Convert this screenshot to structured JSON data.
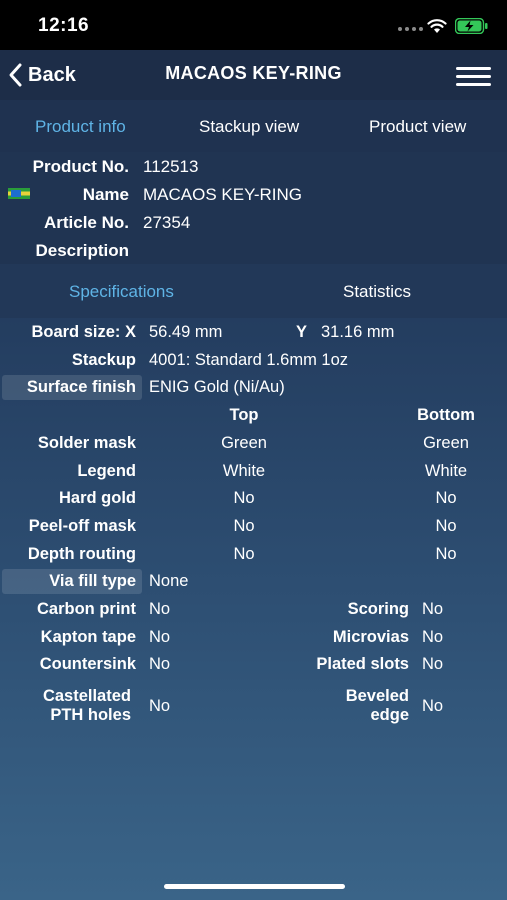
{
  "status": {
    "time": "12:16",
    "icons": [
      "wifi-icon",
      "battery-charging-icon"
    ],
    "battery_color": "#34c759"
  },
  "nav": {
    "back_label": "Back",
    "title": "MACAOS KEY-RING",
    "back_icon": "chevron-left-icon",
    "menu_icon": "hamburger-menu-icon"
  },
  "top_tabs": [
    "Product info",
    "Stackup view",
    "Product view"
  ],
  "product": {
    "product_no_label": "Product No.",
    "product_no": "112513",
    "name_label": "Name",
    "name": "MACAOS KEY-RING",
    "article_no_label": "Article No.",
    "article_no": "27354",
    "description_label": "Description",
    "description": ""
  },
  "spec_tabs": [
    "Specifications",
    "Statistics"
  ],
  "specs": {
    "board_size_label": "Board size: X",
    "board_x": "56.49 mm",
    "board_y_label": "Y",
    "board_y": "31.16 mm",
    "stackup_label": "Stackup",
    "stackup": "4001: Standard 1.6mm 1oz",
    "surface_finish_label": "Surface finish",
    "surface_finish": "ENIG Gold (Ni/Au)",
    "col_top": "Top",
    "col_bottom": "Bottom",
    "rows": [
      {
        "label": "Solder mask",
        "top": "Green",
        "bottom": "Green"
      },
      {
        "label": "Legend",
        "top": "White",
        "bottom": "White"
      },
      {
        "label": "Hard gold",
        "top": "No",
        "bottom": "No"
      },
      {
        "label": "Peel-off mask",
        "top": "No",
        "bottom": "No"
      },
      {
        "label": "Depth routing",
        "top": "No",
        "bottom": "No"
      }
    ],
    "via_fill_label": "Via fill type",
    "via_fill": "None",
    "carbon_print_label": "Carbon print",
    "carbon_print": "No",
    "scoring_label": "Scoring",
    "scoring": "No",
    "kapton_label": "Kapton tape",
    "kapton": "No",
    "microvias_label": "Microvias",
    "microvias": "No",
    "countersink_label": "Countersink",
    "countersink": "No",
    "plated_slots_label": "Plated slots",
    "plated_slots": "No",
    "castellated_label_1": "Castellated",
    "castellated_label_2": "PTH holes",
    "castellated": "No",
    "beveled_label_1": "Beveled",
    "beveled_label_2": "edge",
    "beveled": "No"
  },
  "colors": {
    "accent": "#5fb4e6",
    "background_top": "#1a2a44",
    "background_bottom": "#3a6488"
  }
}
